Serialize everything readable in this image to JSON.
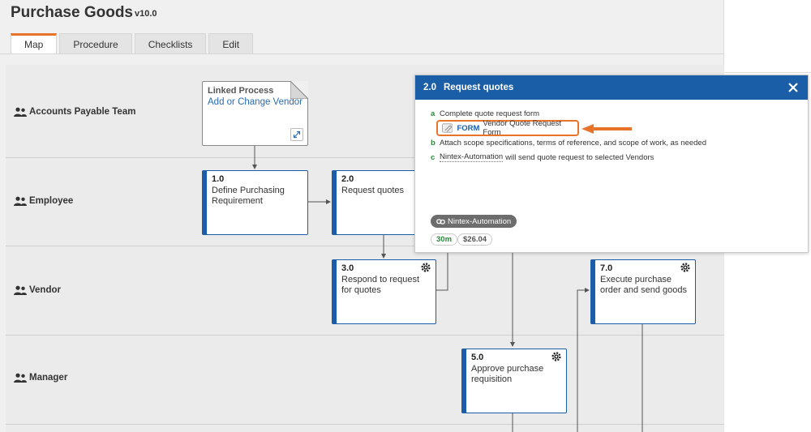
{
  "header": {
    "title": "Purchase Goods",
    "version": "v10.0"
  },
  "tabs": [
    {
      "label": "Map",
      "active": true
    },
    {
      "label": "Procedure",
      "active": false
    },
    {
      "label": "Checklists",
      "active": false
    },
    {
      "label": "Edit",
      "active": false
    }
  ],
  "lanes": [
    {
      "label": "Accounts Payable Team"
    },
    {
      "label": "Employee"
    },
    {
      "label": "Vendor"
    },
    {
      "label": "Manager"
    }
  ],
  "linked_process": {
    "title": "Linked Process",
    "link_label": "Add or Change Vendor"
  },
  "nodes": [
    {
      "num": "1.0",
      "text": "Define Purchasing Requirement"
    },
    {
      "num": "2.0",
      "text": "Request quotes"
    },
    {
      "num": "3.0",
      "text": "Respond to request for quotes"
    },
    {
      "num": "7.0",
      "text": "Execute purchase order and send goods"
    },
    {
      "num": "5.0",
      "text": "Approve purchase requisition"
    }
  ],
  "panel": {
    "num": "2.0",
    "title": "Request quotes",
    "steps": [
      {
        "letter": "a",
        "text": "Complete quote request form"
      },
      {
        "letter": "b",
        "text": "Attach scope specifications, terms of reference, and scope of work, as needed"
      },
      {
        "letter": "c",
        "link": "Nintex-Automation",
        "text": "will send quote request to selected Vendors"
      }
    ],
    "form": {
      "type": "FORM",
      "name": "Vendor Quote Request Form"
    },
    "system_badge": "Nintex-Automation",
    "duration": "30m",
    "cost": "$26.04"
  },
  "colors": {
    "accent": "#e8742b",
    "primary": "#1b5ea8",
    "lane_bg": "#ebebeb",
    "success": "#2a8a3c"
  }
}
